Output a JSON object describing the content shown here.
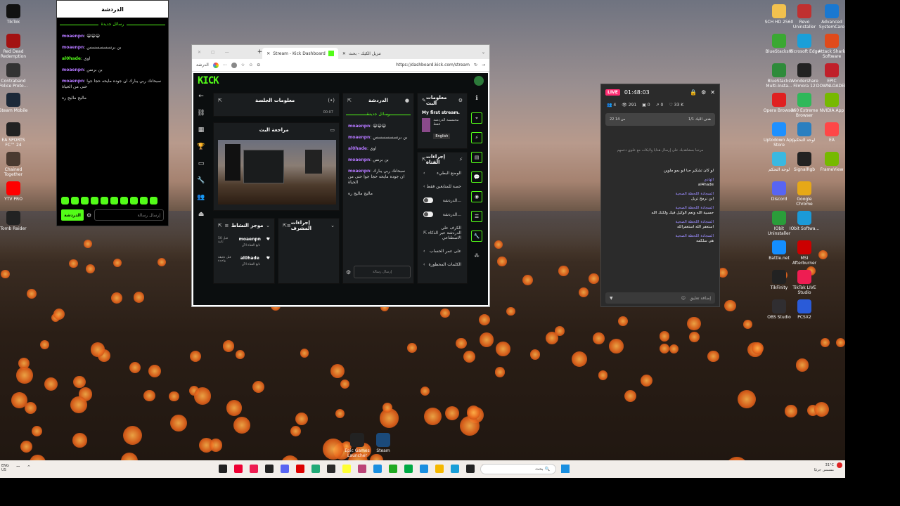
{
  "desktop_left": [
    {
      "name": "icon-tiktok",
      "label": "TikTok",
      "color": "#111"
    },
    {
      "name": "icon-rdr",
      "label": "Red Dead Redemption",
      "color": "#a31212"
    },
    {
      "name": "icon-contraband",
      "label": "Contraband Police Proto...",
      "color": "#333"
    },
    {
      "name": "icon-steam-mobile",
      "label": "Steam Mobile",
      "color": "#1b2838"
    },
    {
      "name": "icon-easports",
      "label": "EA SPORTS FC™ 24",
      "color": "#222"
    },
    {
      "name": "icon-chained",
      "label": "Chained Together",
      "color": "#4a3a30"
    },
    {
      "name": "icon-yt",
      "label": "YTV PRO",
      "color": "#ff0000"
    },
    {
      "name": "icon-tombraider",
      "label": "Tomb Raider",
      "color": "#222"
    }
  ],
  "desktop_right_col1": [
    {
      "name": "icon-folder",
      "label": "SCH HD 2560",
      "color": "#f2c14e"
    },
    {
      "name": "icon-bluestacks",
      "label": "BlueStacks 5",
      "color": "#3aa832"
    },
    {
      "name": "icon-bluestacks-multi",
      "label": "BlueStacks Multi-Insta...",
      "color": "#2e8b3a"
    },
    {
      "name": "icon-opera",
      "label": "Opera Browser",
      "color": "#e02020"
    },
    {
      "name": "icon-uptodown",
      "label": "Uptodown App Store",
      "color": "#1e90ff"
    },
    {
      "name": "icon-smartdefrag",
      "label": "لوحة التحكم",
      "color": "#3ab8e0"
    },
    {
      "name": "icon-discord",
      "label": "Discord",
      "color": "#5865f2"
    },
    {
      "name": "icon-iobit-un",
      "label": "IObit Uninstaller",
      "color": "#2a9d3a"
    },
    {
      "name": "icon-battlenet",
      "label": "Battle.net",
      "color": "#148eff"
    },
    {
      "name": "icon-tikfinity",
      "label": "TikFinity",
      "color": "#222"
    },
    {
      "name": "icon-obs",
      "label": "OBS Studio",
      "color": "#302e31"
    }
  ],
  "desktop_right_col2": [
    {
      "name": "icon-revo",
      "label": "Revo Uninstaller",
      "color": "#c03030"
    },
    {
      "name": "icon-edge",
      "label": "Microsoft Edge",
      "color": "#1a9fd8"
    },
    {
      "name": "icon-wondershare",
      "label": "Wondershare Filmora 12",
      "color": "#222"
    },
    {
      "name": "icon-360",
      "label": "360 Extreme Browser",
      "color": "#2fb85a"
    },
    {
      "name": "icon-control",
      "label": "لوحة التحكم",
      "color": "#2a7fc0"
    },
    {
      "name": "icon-signal",
      "label": "SignalRgb",
      "color": "#222"
    },
    {
      "name": "icon-chrome",
      "label": "Google Chrome",
      "color": "#e6a817"
    },
    {
      "name": "icon-iobit-soft",
      "label": "IObit Softwa...",
      "color": "#1b9ad8"
    },
    {
      "name": "icon-msi",
      "label": "MSI Afterburner",
      "color": "#c00"
    },
    {
      "name": "icon-tiktok-live",
      "label": "TikTok LIVE Studio",
      "color": "#ee1d52"
    },
    {
      "name": "icon-pcsx2",
      "label": "PCSX2",
      "color": "#2a5bd8"
    }
  ],
  "desktop_right_col3": [
    {
      "name": "icon-advanced",
      "label": "Advanced SystemCare",
      "color": "#1a78d0"
    },
    {
      "name": "icon-shark",
      "label": "Attack Shark Software",
      "color": "#e04a1a"
    },
    {
      "name": "icon-epic-dl",
      "label": "EPIC DOWNLOADER",
      "color": "#c0202a"
    },
    {
      "name": "icon-nvidia",
      "label": "NVIDIA App",
      "color": "#76b900"
    },
    {
      "name": "icon-ea",
      "label": "EA",
      "color": "#ff4747"
    },
    {
      "name": "icon-frameview",
      "label": "FrameView",
      "color": "#76b900"
    }
  ],
  "desktop_bottom": [
    {
      "name": "icon-epic",
      "label": "Epic Games Launcher",
      "color": "#222"
    },
    {
      "name": "icon-steam",
      "label": "Steam",
      "color": "#1b4a7a"
    }
  ],
  "chatpop": {
    "title": "الدردشة",
    "new_messages": "رسائل جديدة",
    "messages": [
      {
        "user": "moaenpn",
        "text": "😀😀😀",
        "green": false
      },
      {
        "user": "moaenpn",
        "text": "بن برنسسسسسس",
        "green": false
      },
      {
        "user": "al0hade",
        "text": "اوي",
        "green": true
      },
      {
        "user": "moaenpn",
        "text": "بن برنس",
        "green": false
      },
      {
        "user": "moaenpn",
        "text": "سبحانك ربي يبارك ان جوده مايحه حجا جوا حتى من الحياة",
        "green": false
      },
      {
        "user": "",
        "text": "ماليج ماليج ره",
        "green": false
      }
    ],
    "send_label": "الدردشة",
    "input_placeholder": "إرسال رسالة"
  },
  "browser": {
    "tab1": "تنزيل الكيك - بحث",
    "tab2": "Stream - Kick Dashboard",
    "url": "https://dashboard.kick.com/stream",
    "profile": "الدرشة",
    "logo": "KICK",
    "panels": {
      "session": "معلومات الجلسة",
      "chat": "الدردشة",
      "stream_info": "معلومات البث",
      "preview": "مراجعة البث",
      "activity": "موجز النشاط",
      "mod_actions": "إجراءات المشرف",
      "quick_actions": "إجراءات الفتاة"
    },
    "session_time": "00:07",
    "stream_title": "My first stream.",
    "stream_category": "محتمسة الدردشة فقط",
    "stream_lang": "English",
    "chat_new": "رسائل جديدة",
    "chat_messages": [
      {
        "user": "moaenpn",
        "text": "😀😀😀"
      },
      {
        "user": "moaenpn",
        "text": "بن برنسسسسسس"
      },
      {
        "user": "al0hade",
        "text": "اوي"
      },
      {
        "user": "moaenpn",
        "text": "بن برنس"
      },
      {
        "user": "moaenpn",
        "text": "سبحانك ربي يبارك ان جوده مايحه حجا جوا حتى من الحياة"
      },
      {
        "user": "",
        "text": "ماليج ماليج ره"
      }
    ],
    "chat_input": "إرسال رسالة",
    "activity": [
      {
        "user": "moaenpn",
        "time": "قبل 50 ثانية",
        "text": "تابع القناة الآن"
      },
      {
        "user": "al0hade",
        "time": "قبل دقيقة واحدة",
        "text": "تابع القناة الآن"
      }
    ],
    "quick_rows": [
      {
        "label": "الوضع البطيء",
        "type": "arrow"
      },
      {
        "label": "حصة للمتابعين فقط",
        "type": "arrow"
      },
      {
        "label": "الدردشة...",
        "type": "toggle"
      },
      {
        "label": "الدردشة...",
        "type": "toggle"
      },
      {
        "label": "الكرف على الدردشة عبر الذكاء الاصطناعي",
        "type": "link"
      },
      {
        "label": "على عمر الحساب",
        "type": "arrow"
      },
      {
        "label": "الكلمات المحظورة",
        "type": "arrow"
      }
    ]
  },
  "live": {
    "badge": "LIVE",
    "time": "01:48:03",
    "stats": [
      "4",
      "291",
      "0",
      "0",
      "33 K"
    ],
    "goal_label": "هدف الليك 1/1",
    "goal_value": "22 من 14",
    "welcome": "مرحبا بمشاهديك على إرسال هدايا ولايكات مع علوي دعمهم",
    "messages": [
      {
        "name": "",
        "text": "لو كان تشكير حبا ابو بمو ملوين"
      },
      {
        "name": "الهادي",
        "text": "al4hade"
      },
      {
        "name": "السجادة اللحظة الصحية",
        "text": "ابن نرمح تربل"
      },
      {
        "name": "السجادة اللحظة الصحية",
        "text": "حسبية الله ونعم الوكيل فيك ولكنك الله"
      },
      {
        "name": "السجادة اللحظة الصحية",
        "text": "استغفر الله استغفرالله"
      },
      {
        "name": "السجادة اللحظة الصحية",
        "text": "هي سلكمه"
      }
    ],
    "comment_placeholder": "إضافة تعليق"
  },
  "taskbar": {
    "lang": "ENG US",
    "search_placeholder": "بحث",
    "weather": "31°C",
    "weather_desc": "مشمس جزئيًا"
  }
}
